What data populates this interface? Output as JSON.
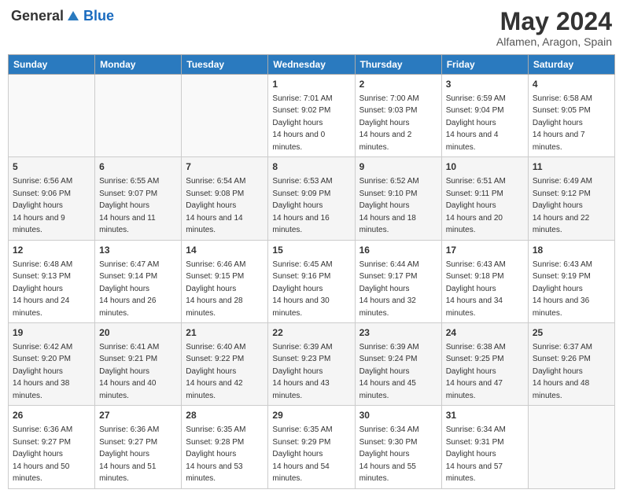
{
  "header": {
    "logo_general": "General",
    "logo_blue": "Blue",
    "month": "May 2024",
    "location": "Alfamen, Aragon, Spain"
  },
  "weekdays": [
    "Sunday",
    "Monday",
    "Tuesday",
    "Wednesday",
    "Thursday",
    "Friday",
    "Saturday"
  ],
  "weeks": [
    {
      "row_class": "week-odd",
      "days": [
        {
          "num": "",
          "empty": true
        },
        {
          "num": "",
          "empty": true
        },
        {
          "num": "",
          "empty": true
        },
        {
          "num": "1",
          "sunrise": "7:01 AM",
          "sunset": "9:02 PM",
          "daylight": "14 hours and 0 minutes."
        },
        {
          "num": "2",
          "sunrise": "7:00 AM",
          "sunset": "9:03 PM",
          "daylight": "14 hours and 2 minutes."
        },
        {
          "num": "3",
          "sunrise": "6:59 AM",
          "sunset": "9:04 PM",
          "daylight": "14 hours and 4 minutes."
        },
        {
          "num": "4",
          "sunrise": "6:58 AM",
          "sunset": "9:05 PM",
          "daylight": "14 hours and 7 minutes."
        }
      ]
    },
    {
      "row_class": "week-even",
      "days": [
        {
          "num": "5",
          "sunrise": "6:56 AM",
          "sunset": "9:06 PM",
          "daylight": "14 hours and 9 minutes."
        },
        {
          "num": "6",
          "sunrise": "6:55 AM",
          "sunset": "9:07 PM",
          "daylight": "14 hours and 11 minutes."
        },
        {
          "num": "7",
          "sunrise": "6:54 AM",
          "sunset": "9:08 PM",
          "daylight": "14 hours and 14 minutes."
        },
        {
          "num": "8",
          "sunrise": "6:53 AM",
          "sunset": "9:09 PM",
          "daylight": "14 hours and 16 minutes."
        },
        {
          "num": "9",
          "sunrise": "6:52 AM",
          "sunset": "9:10 PM",
          "daylight": "14 hours and 18 minutes."
        },
        {
          "num": "10",
          "sunrise": "6:51 AM",
          "sunset": "9:11 PM",
          "daylight": "14 hours and 20 minutes."
        },
        {
          "num": "11",
          "sunrise": "6:49 AM",
          "sunset": "9:12 PM",
          "daylight": "14 hours and 22 minutes."
        }
      ]
    },
    {
      "row_class": "week-odd",
      "days": [
        {
          "num": "12",
          "sunrise": "6:48 AM",
          "sunset": "9:13 PM",
          "daylight": "14 hours and 24 minutes."
        },
        {
          "num": "13",
          "sunrise": "6:47 AM",
          "sunset": "9:14 PM",
          "daylight": "14 hours and 26 minutes."
        },
        {
          "num": "14",
          "sunrise": "6:46 AM",
          "sunset": "9:15 PM",
          "daylight": "14 hours and 28 minutes."
        },
        {
          "num": "15",
          "sunrise": "6:45 AM",
          "sunset": "9:16 PM",
          "daylight": "14 hours and 30 minutes."
        },
        {
          "num": "16",
          "sunrise": "6:44 AM",
          "sunset": "9:17 PM",
          "daylight": "14 hours and 32 minutes."
        },
        {
          "num": "17",
          "sunrise": "6:43 AM",
          "sunset": "9:18 PM",
          "daylight": "14 hours and 34 minutes."
        },
        {
          "num": "18",
          "sunrise": "6:43 AM",
          "sunset": "9:19 PM",
          "daylight": "14 hours and 36 minutes."
        }
      ]
    },
    {
      "row_class": "week-even",
      "days": [
        {
          "num": "19",
          "sunrise": "6:42 AM",
          "sunset": "9:20 PM",
          "daylight": "14 hours and 38 minutes."
        },
        {
          "num": "20",
          "sunrise": "6:41 AM",
          "sunset": "9:21 PM",
          "daylight": "14 hours and 40 minutes."
        },
        {
          "num": "21",
          "sunrise": "6:40 AM",
          "sunset": "9:22 PM",
          "daylight": "14 hours and 42 minutes."
        },
        {
          "num": "22",
          "sunrise": "6:39 AM",
          "sunset": "9:23 PM",
          "daylight": "14 hours and 43 minutes."
        },
        {
          "num": "23",
          "sunrise": "6:39 AM",
          "sunset": "9:24 PM",
          "daylight": "14 hours and 45 minutes."
        },
        {
          "num": "24",
          "sunrise": "6:38 AM",
          "sunset": "9:25 PM",
          "daylight": "14 hours and 47 minutes."
        },
        {
          "num": "25",
          "sunrise": "6:37 AM",
          "sunset": "9:26 PM",
          "daylight": "14 hours and 48 minutes."
        }
      ]
    },
    {
      "row_class": "week-odd",
      "days": [
        {
          "num": "26",
          "sunrise": "6:36 AM",
          "sunset": "9:27 PM",
          "daylight": "14 hours and 50 minutes."
        },
        {
          "num": "27",
          "sunrise": "6:36 AM",
          "sunset": "9:27 PM",
          "daylight": "14 hours and 51 minutes."
        },
        {
          "num": "28",
          "sunrise": "6:35 AM",
          "sunset": "9:28 PM",
          "daylight": "14 hours and 53 minutes."
        },
        {
          "num": "29",
          "sunrise": "6:35 AM",
          "sunset": "9:29 PM",
          "daylight": "14 hours and 54 minutes."
        },
        {
          "num": "30",
          "sunrise": "6:34 AM",
          "sunset": "9:30 PM",
          "daylight": "14 hours and 55 minutes."
        },
        {
          "num": "31",
          "sunrise": "6:34 AM",
          "sunset": "9:31 PM",
          "daylight": "14 hours and 57 minutes."
        },
        {
          "num": "",
          "empty": true
        }
      ]
    }
  ]
}
